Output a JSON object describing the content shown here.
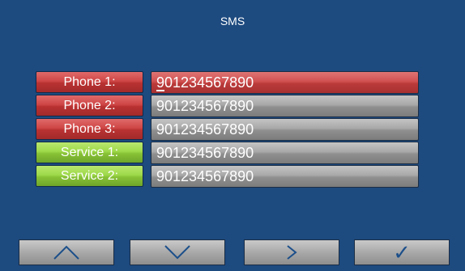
{
  "title": "SMS",
  "rows": [
    {
      "label": "Phone 1:",
      "value": "901234567890"
    },
    {
      "label": "Phone 2:",
      "value": "901234567890"
    },
    {
      "label": "Phone 3:",
      "value": "901234567890"
    },
    {
      "label": "Service 1:",
      "value": "901234567890"
    },
    {
      "label": "Service 2:",
      "value": "901234567890"
    }
  ],
  "buttons": {
    "up": "∧",
    "down": "∨",
    "next": ">",
    "confirm": "✓"
  },
  "icons": [
    "up-icon",
    "down-icon",
    "right-icon",
    "check-icon"
  ],
  "colors": {
    "background": "#1d4a7f",
    "phone_label": "#c23a3a",
    "service_label": "#9ed94a",
    "active_field": "#c94545",
    "inactive_field": "#9a9a9a",
    "button_glyph": "#1c4f8a"
  }
}
